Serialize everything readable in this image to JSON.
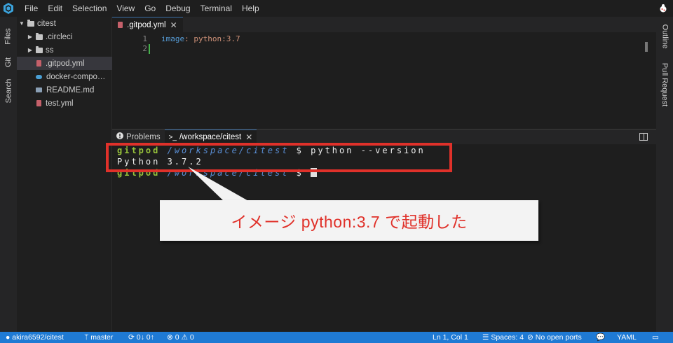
{
  "menubar": {
    "items": [
      "File",
      "Edit",
      "Selection",
      "View",
      "Go",
      "Debug",
      "Terminal",
      "Help"
    ]
  },
  "activity_left": {
    "tabs": [
      "Files",
      "Git",
      "Search"
    ]
  },
  "activity_right": {
    "tabs": [
      "Outline",
      "Pull Request"
    ]
  },
  "sidebar": {
    "root": "citest",
    "folders": [
      ".circleci",
      "ss"
    ],
    "files": [
      ".gitpod.yml",
      "docker-compo…",
      "README.md",
      "test.yml"
    ],
    "selected": ".gitpod.yml"
  },
  "editor": {
    "tab_label": ".gitpod.yml",
    "line_numbers": [
      "1",
      "2"
    ],
    "line1_key": "image",
    "line1_colon": ":",
    "line1_value": " python:3.7"
  },
  "panel": {
    "tabs": [
      "Problems",
      "/workspace/citest"
    ],
    "problems_icon": "info-circle-icon",
    "terminal_prefix": ">_"
  },
  "terminal": {
    "line1_user": "gitpod",
    "line1_path": "/workspace/citest",
    "line1_prompt": "$",
    "line1_cmd": "python --version",
    "line2_output": "Python 3.7.2",
    "line3_user": "gitpod",
    "line3_path": "/workspace/citest",
    "line3_prompt": "$"
  },
  "callout": {
    "text": "イメージ python:3.7 で起動した"
  },
  "statusbar": {
    "repo": "akira6592/citest",
    "branch": "master",
    "sync": "0↓ 0↑",
    "problems": "0 ⚠ 0",
    "position": "Ln 1, Col 1",
    "spaces": "Spaces: 4",
    "ports": "No open ports",
    "language": "YAML"
  },
  "colors": {
    "accent": "#1f7ad4",
    "highlight": "#e0312a",
    "terminal_user": "#98c43b",
    "terminal_path": "#5a8fd6"
  }
}
